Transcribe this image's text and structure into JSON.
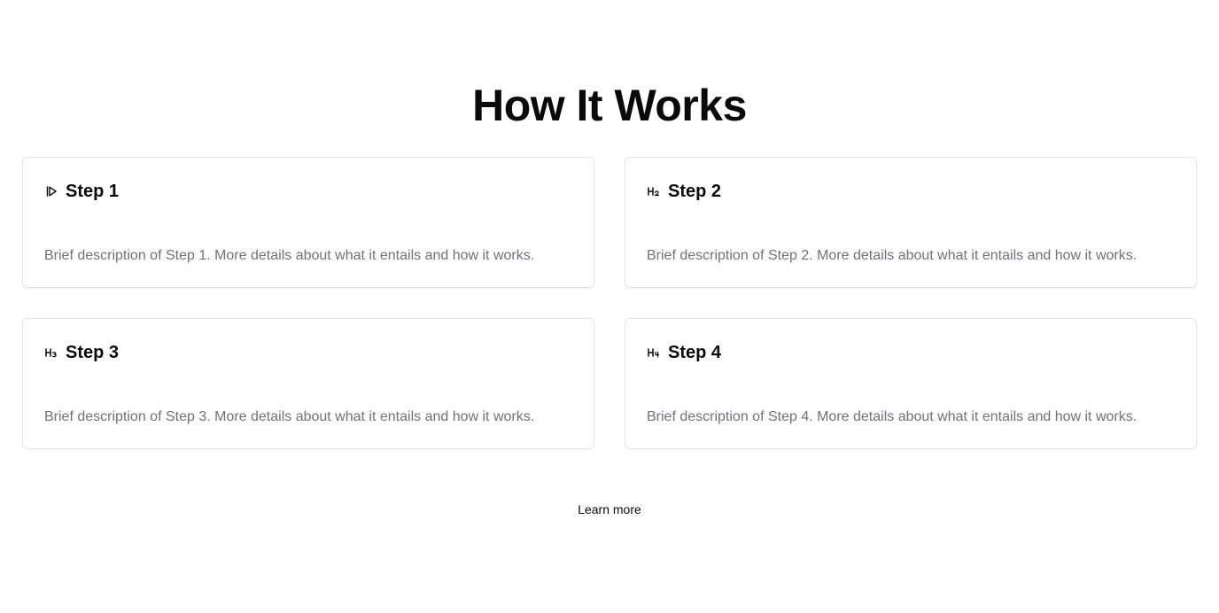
{
  "section": {
    "title": "How It Works",
    "learn_more_label": "Learn more"
  },
  "steps": [
    {
      "icon": "play-step-icon",
      "title": "Step 1",
      "description": "Brief description of Step 1. More details about what it entails and how it works."
    },
    {
      "icon": "heading-2-icon",
      "title": "Step 2",
      "description": "Brief description of Step 2. More details about what it entails and how it works."
    },
    {
      "icon": "heading-3-icon",
      "title": "Step 3",
      "description": "Brief description of Step 3. More details about what it entails and how it works."
    },
    {
      "icon": "heading-4-icon",
      "title": "Step 4",
      "description": "Brief description of Step 4. More details about what it entails and how it works."
    }
  ]
}
